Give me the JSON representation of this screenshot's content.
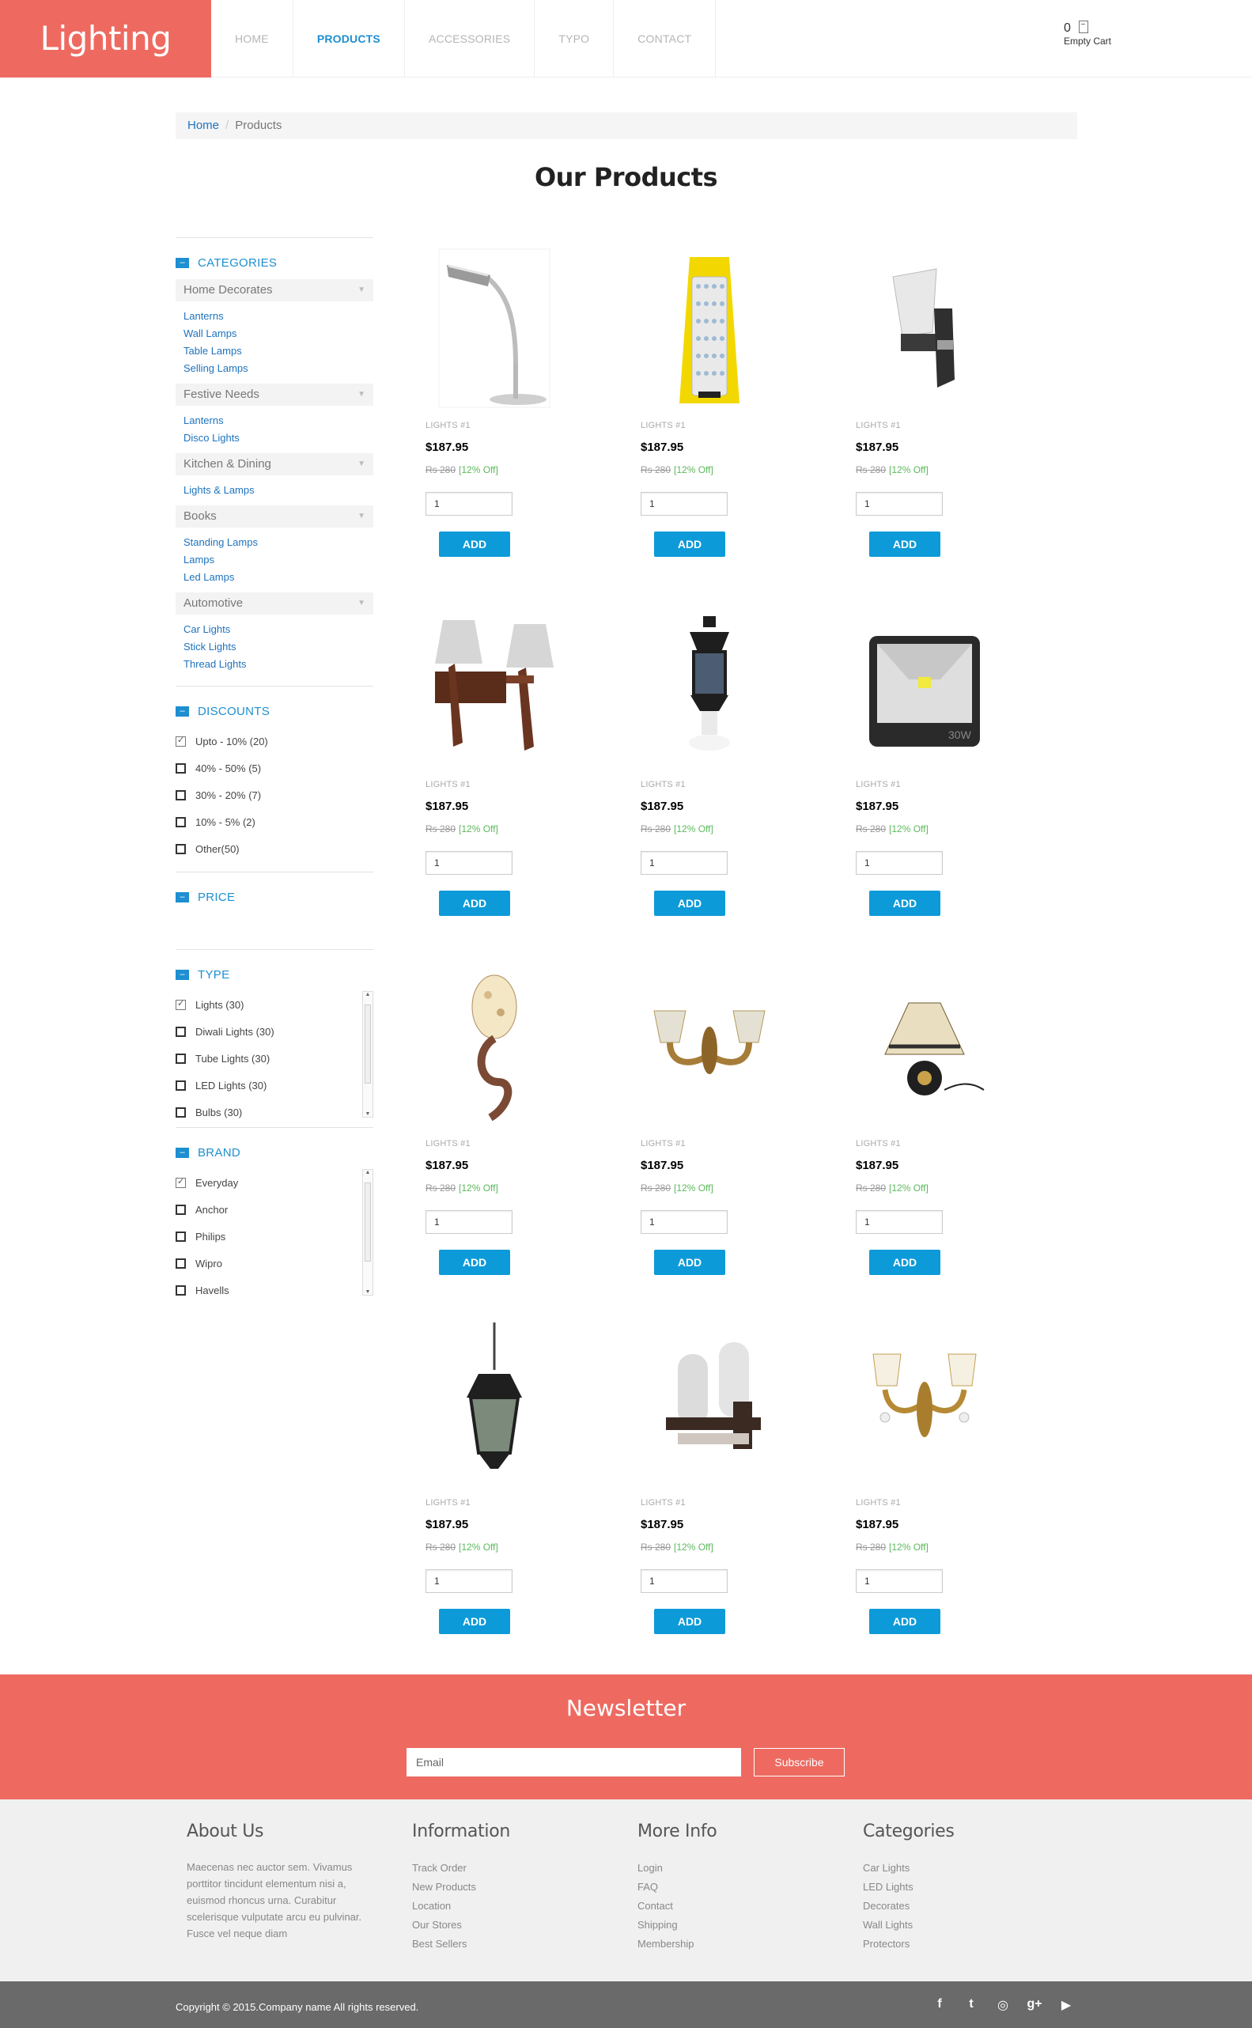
{
  "brand": {
    "logo": "Lighting",
    "accent": "#ee6a61",
    "link": "#1e8fd0"
  },
  "nav": {
    "items": [
      {
        "label": "HOME"
      },
      {
        "label": "PRODUCTS"
      },
      {
        "label": "ACCESSORIES"
      },
      {
        "label": "TYPO"
      },
      {
        "label": "CONTACT"
      }
    ],
    "active": "PRODUCTS"
  },
  "cart": {
    "count": "0",
    "label": "Empty Cart",
    "icon": "cart-icon"
  },
  "breadcrumb": {
    "home": "Home",
    "separator": "/",
    "current": "Products"
  },
  "page_title": "Our Products",
  "sidebar": {
    "categories": {
      "title": "CATEGORIES",
      "groups": [
        {
          "name": "Home Decorates",
          "links": [
            "Lanterns",
            "Wall Lamps",
            "Table Lamps",
            "Selling Lamps"
          ]
        },
        {
          "name": "Festive Needs",
          "links": [
            "Lanterns",
            "Disco Lights"
          ]
        },
        {
          "name": "Kitchen & Dining",
          "links": [
            "Lights & Lamps"
          ]
        },
        {
          "name": "Books",
          "links": [
            "Standing Lamps",
            "Lamps",
            "Led Lamps"
          ]
        },
        {
          "name": "Automotive",
          "links": [
            "Car Lights",
            "Stick Lights",
            "Thread Lights"
          ]
        }
      ]
    },
    "discounts": {
      "title": "DISCOUNTS",
      "options": [
        {
          "label": "Upto - 10% (20)",
          "checked": true
        },
        {
          "label": "40% - 50% (5)",
          "checked": false
        },
        {
          "label": "30% - 20% (7)",
          "checked": false
        },
        {
          "label": "10% - 5% (2)",
          "checked": false
        },
        {
          "label": "Other(50)",
          "checked": false
        }
      ]
    },
    "price": {
      "title": "PRICE"
    },
    "type": {
      "title": "TYPE",
      "options": [
        {
          "label": "Lights (30)",
          "checked": true
        },
        {
          "label": "Diwali Lights (30)",
          "checked": false
        },
        {
          "label": "Tube Lights (30)",
          "checked": false
        },
        {
          "label": "LED Lights (30)",
          "checked": false
        },
        {
          "label": "Bulbs (30)",
          "checked": false
        }
      ]
    },
    "brand": {
      "title": "BRAND",
      "options": [
        {
          "label": "Everyday",
          "checked": true
        },
        {
          "label": "Anchor",
          "checked": false
        },
        {
          "label": "Philips",
          "checked": false
        },
        {
          "label": "Wipro",
          "checked": false
        },
        {
          "label": "Havells",
          "checked": false
        }
      ]
    }
  },
  "products": [
    {
      "icon": "desk-lamp-icon",
      "category": "LIGHTS #1",
      "price": "$187.95",
      "old_price": "Rs 280",
      "discount": "[12% Off]",
      "qty": "1",
      "button": "ADD"
    },
    {
      "icon": "emergency-lantern-icon",
      "category": "LIGHTS #1",
      "price": "$187.95",
      "old_price": "Rs 280",
      "discount": "[12% Off]",
      "qty": "1",
      "button": "ADD"
    },
    {
      "icon": "wall-sconce-icon",
      "category": "LIGHTS #1",
      "price": "$187.95",
      "old_price": "Rs 280",
      "discount": "[12% Off]",
      "qty": "1",
      "button": "ADD"
    },
    {
      "icon": "double-wall-lamp-icon",
      "category": "LIGHTS #1",
      "price": "$187.95",
      "old_price": "Rs 280",
      "discount": "[12% Off]",
      "qty": "1",
      "button": "ADD"
    },
    {
      "icon": "gate-lamp-icon",
      "category": "LIGHTS #1",
      "price": "$187.95",
      "old_price": "Rs 280",
      "discount": "[12% Off]",
      "qty": "1",
      "button": "ADD"
    },
    {
      "icon": "flood-light-icon",
      "category": "LIGHTS #1",
      "price": "$187.95",
      "old_price": "Rs 280",
      "discount": "[12% Off]",
      "qty": "1",
      "button": "ADD"
    },
    {
      "icon": "mosaic-sconce-icon",
      "category": "LIGHTS #1",
      "price": "$187.95",
      "old_price": "Rs 280",
      "discount": "[12% Off]",
      "qty": "1",
      "button": "ADD"
    },
    {
      "icon": "brass-wall-lamp-icon",
      "category": "LIGHTS #1",
      "price": "$187.95",
      "old_price": "Rs 280",
      "discount": "[12% Off]",
      "qty": "1",
      "button": "ADD"
    },
    {
      "icon": "table-lamp-icon",
      "category": "LIGHTS #1",
      "price": "$187.95",
      "old_price": "Rs 280",
      "discount": "[12% Off]",
      "qty": "1",
      "button": "ADD"
    },
    {
      "icon": "hanging-lantern-icon",
      "category": "LIGHTS #1",
      "price": "$187.95",
      "old_price": "Rs 280",
      "discount": "[12% Off]",
      "qty": "1",
      "button": "ADD"
    },
    {
      "icon": "twin-wall-light-icon",
      "category": "LIGHTS #1",
      "price": "$187.95",
      "old_price": "Rs 280",
      "discount": "[12% Off]",
      "qty": "1",
      "button": "ADD"
    },
    {
      "icon": "gold-chandelier-icon",
      "category": "LIGHTS #1",
      "price": "$187.95",
      "old_price": "Rs 280",
      "discount": "[12% Off]",
      "qty": "1",
      "button": "ADD"
    }
  ],
  "newsletter": {
    "title": "Newsletter",
    "placeholder": "Email",
    "button": "Subscribe"
  },
  "footer": {
    "about": {
      "title": "About Us",
      "text": "Maecenas nec auctor sem. Vivamus porttitor tincidunt elementum nisi a, euismod rhoncus urna. Curabitur scelerisque vulputate arcu eu pulvinar. Fusce vel neque diam"
    },
    "information": {
      "title": "Information",
      "links": [
        "Track Order",
        "New Products",
        "Location",
        "Our Stores",
        "Best Sellers"
      ]
    },
    "more_info": {
      "title": "More Info",
      "links": [
        "Login",
        "FAQ",
        "Contact",
        "Shipping",
        "Membership"
      ]
    },
    "categories": {
      "title": "Categories",
      "links": [
        "Car Lights",
        "LED Lights",
        "Decorates",
        "Wall Lights",
        "Protectors"
      ]
    }
  },
  "copyright": "Copyright © 2015.Company name All rights reserved.",
  "socials": [
    {
      "icon": "facebook-icon",
      "glyph": "f"
    },
    {
      "icon": "twitter-icon",
      "glyph": "t"
    },
    {
      "icon": "dribbble-icon",
      "glyph": "◎"
    },
    {
      "icon": "google-plus-icon",
      "glyph": "g+"
    },
    {
      "icon": "youtube-icon",
      "glyph": "▶"
    }
  ]
}
